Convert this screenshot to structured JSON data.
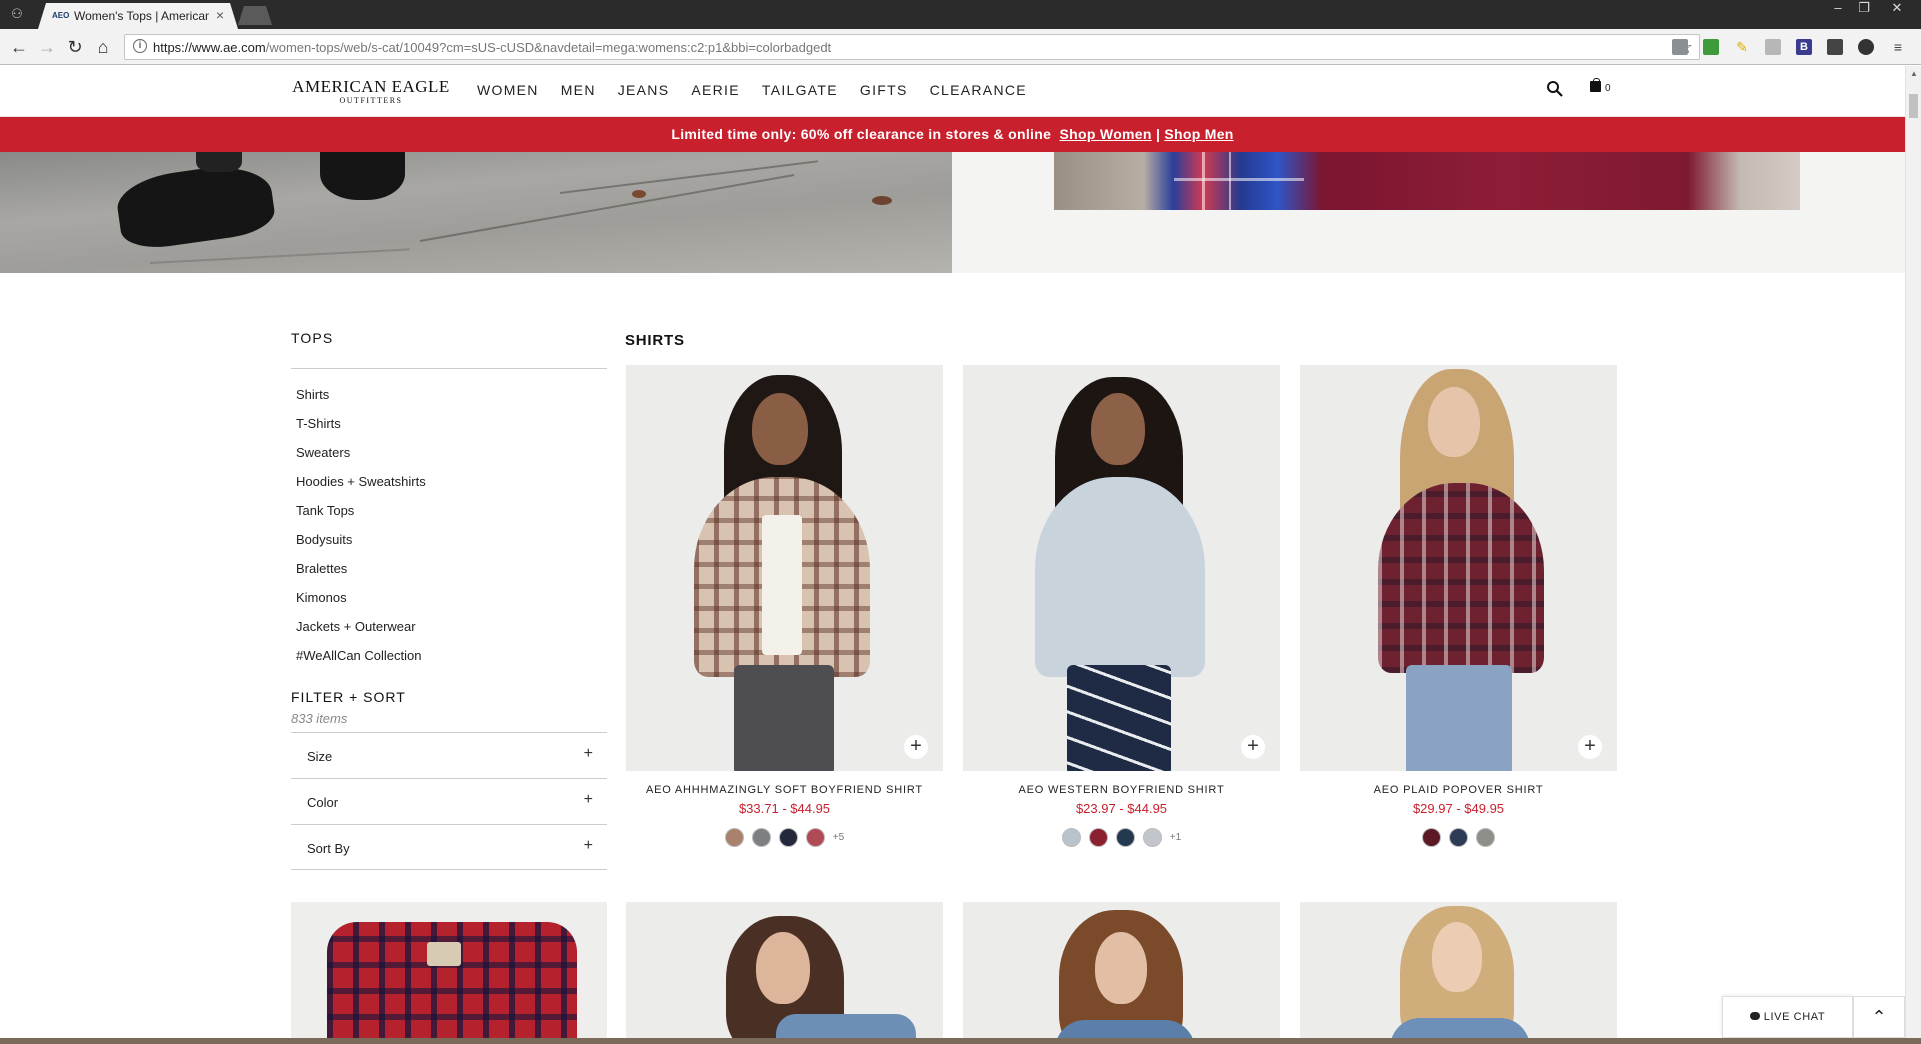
{
  "browser": {
    "tab_title": "Women's Tops | American Eagle",
    "tab_favicon": "AEO",
    "url_host": "https://www.ae.com",
    "url_path": "/women-tops/web/s-cat/10049?cm=sUS-cUSD&navdetail=mega:womens:c2:p1&bbi=colorbadgedt"
  },
  "header": {
    "logo_line1": "AMERICAN EAGLE",
    "logo_line2": "OUTFITTERS",
    "nav": [
      "WOMEN",
      "MEN",
      "JEANS",
      "AERIE",
      "TAILGATE",
      "GIFTS",
      "CLEARANCE"
    ],
    "bag_count": "0"
  },
  "promo": {
    "text": "Limited time only: 60% off clearance in stores & online",
    "link_women": "Shop Women",
    "separator": "|",
    "link_men": "Shop Men",
    "color": "#c8202d"
  },
  "sidebar": {
    "title": "TOPS",
    "categories": [
      "Shirts",
      "T-Shirts",
      "Sweaters",
      "Hoodies + Sweatshirts",
      "Tank Tops",
      "Bodysuits",
      "Bralettes",
      "Kimonos",
      "Jackets + Outerwear",
      "#WeAllCan Collection"
    ],
    "filter_title": "FILTER + SORT",
    "item_count": "833 items",
    "facets": [
      "Size",
      "Color",
      "Sort By"
    ]
  },
  "grid": {
    "title": "SHIRTS",
    "products": [
      {
        "name": "AEO AHHHMAZINGLY SOFT BOYFRIEND SHIRT",
        "price": "$33.71 - $44.95",
        "swatches": [
          "#a9826e",
          "#7d7f83",
          "#23293a",
          "#b04b55"
        ],
        "more": "+5"
      },
      {
        "name": "AEO WESTERN BOYFRIEND SHIRT",
        "price": "$23.97 - $44.95",
        "swatches": [
          "#b9c3cc",
          "#8a2030",
          "#24384f",
          "#c3c5cc"
        ],
        "more": "+1"
      },
      {
        "name": "AEO PLAID POPOVER SHIRT",
        "price": "$29.97 - $49.95",
        "swatches": [
          "#5d1a24",
          "#2d3b55",
          "#8e8f88"
        ],
        "more": ""
      }
    ]
  },
  "floating": {
    "live_chat": "LIVE CHAT"
  }
}
